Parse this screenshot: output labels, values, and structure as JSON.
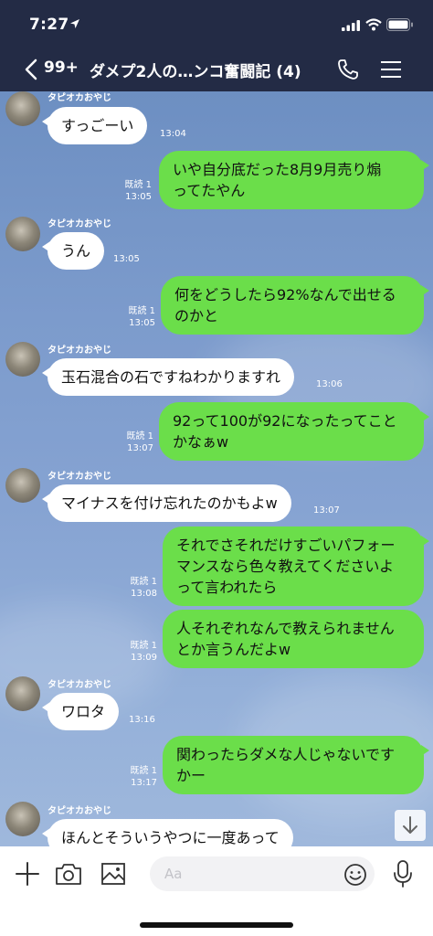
{
  "status_bar": {
    "time": "7:27"
  },
  "header": {
    "back_count": "99+",
    "title": "ダメプ2人の…ンコ奮闘記 (4)"
  },
  "colors": {
    "header_bg": "#232b45",
    "outgoing_bubble": "#6bde4a",
    "incoming_bubble": "#ffffff"
  },
  "messages": [
    {
      "sender": "タピオカおやじ",
      "text": "すっごーい",
      "time": "13:04"
    },
    {
      "read": "既読 1",
      "time": "13:05",
      "lines": [
        "いや自分底だった8月9月売り煽",
        "ってたやん"
      ]
    },
    {
      "sender": "タピオカおやじ",
      "text": "うん",
      "time": "13:05"
    },
    {
      "read": "既読 1",
      "time": "13:05",
      "lines": [
        "何をどうしたら92%なんで出せる",
        "のかと"
      ]
    },
    {
      "sender": "タピオカおやじ",
      "text": "玉石混合の石ですねわかりますれ",
      "time": "13:06"
    },
    {
      "read": "既読 1",
      "time": "13:07",
      "lines": [
        "92って100が92になったってこと",
        "かなぁw"
      ]
    },
    {
      "sender": "タピオカおやじ",
      "text": "マイナスを付け忘れたのかもよw",
      "time": "13:07"
    },
    {
      "read": "既読 1",
      "time": "13:08",
      "lines": [
        "それでさそれだけすごいパフォー",
        "マンスなら色々教えてくださいよ",
        "って言われたら"
      ]
    },
    {
      "read": "既読 1",
      "time": "13:09",
      "lines": [
        "人それぞれなんで教えられません",
        "とか言うんだよw"
      ]
    },
    {
      "sender": "タピオカおやじ",
      "text": "ワロタ",
      "time": "13:16"
    },
    {
      "read": "既読 1",
      "time": "13:17",
      "lines": [
        "関わったらダメな人じゃないです",
        "かー"
      ]
    },
    {
      "sender": "タピオカおやじ",
      "text": "ほんとそういうやつに一度あって"
    }
  ],
  "input": {
    "placeholder": "Aa"
  },
  "icons": [
    "back-chevron-icon",
    "call-icon",
    "menu-icon",
    "plus-icon",
    "camera-icon",
    "image-icon",
    "emoji-icon",
    "mic-icon",
    "scroll-down-icon"
  ]
}
